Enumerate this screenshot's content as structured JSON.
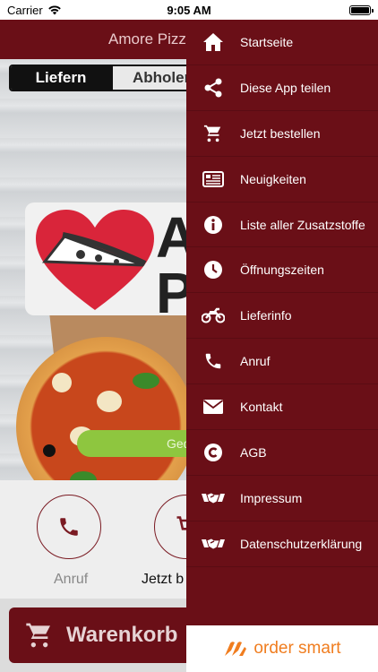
{
  "status_bar": {
    "carrier": "Carrier",
    "time": "9:05 AM"
  },
  "app": {
    "title": "Amore Pizza",
    "segment": {
      "delivery": "Liefern",
      "pickup": "Abholen"
    },
    "logo_letters": "A\nP",
    "green_pill_text": "Ged",
    "call_label": "Anruf",
    "order_label": "Jetzt b",
    "cart_label": "Warenkorb"
  },
  "drawer": {
    "items": [
      {
        "label": "Startseite",
        "icon": "home-icon"
      },
      {
        "label": "Diese App teilen",
        "icon": "share-icon"
      },
      {
        "label": "Jetzt bestellen",
        "icon": "cart-icon"
      },
      {
        "label": "Neuigkeiten",
        "icon": "news-icon"
      },
      {
        "label": "Liste aller Zusatzstoffe",
        "icon": "info-icon"
      },
      {
        "label": "Öffnungszeiten",
        "icon": "clock-icon"
      },
      {
        "label": "Lieferinfo",
        "icon": "motorcycle-icon"
      },
      {
        "label": "Anruf",
        "icon": "phone-icon"
      },
      {
        "label": "Kontakt",
        "icon": "mail-icon"
      },
      {
        "label": "AGB",
        "icon": "copyright-icon"
      },
      {
        "label": "Impressum",
        "icon": "handshake-icon"
      },
      {
        "label": "Datenschutzerklärung",
        "icon": "handshake-icon"
      }
    ]
  },
  "brand": {
    "name": "order smart"
  },
  "colors": {
    "primary": "#6a0f17",
    "accent": "#f07d1f",
    "green": "#8ec63f"
  }
}
